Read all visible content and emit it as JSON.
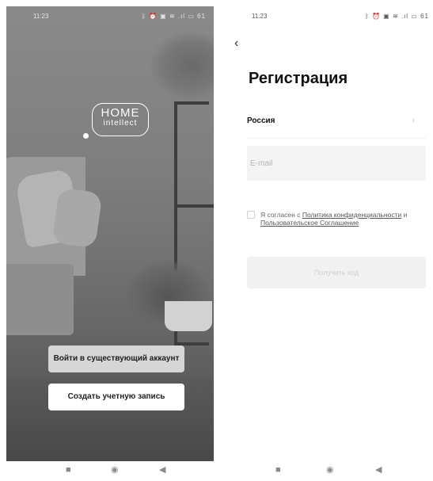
{
  "left_screen": {
    "status_bar": {
      "time": "11:23",
      "icons": "ᛒ ⏰ ▣ ≋ .ıl ▭ 61"
    },
    "logo": {
      "line1": "HOME",
      "line2": "intellect"
    },
    "buttons": {
      "login_label": "Войти в существующий аккаунт",
      "create_label": "Создать учетную запись"
    },
    "nav": {
      "recent": "■",
      "home": "◉",
      "back": "◀"
    }
  },
  "right_screen": {
    "status_bar": {
      "time": "11:23",
      "icons": "ᛒ ⏰ ▣ ≋ .ıl ▭ 61"
    },
    "title": "Регистрация",
    "country": {
      "value": "Россия"
    },
    "email": {
      "placeholder": "E-mail",
      "value": ""
    },
    "agreement": {
      "prefix": "Я согласен с ",
      "privacy_link": "Политика конфиденциальности",
      "middle": " и ",
      "terms_link": "Пользовательское Соглашение"
    },
    "submit_label": "Получить код",
    "nav": {
      "recent": "■",
      "home": "◉",
      "back": "◀"
    }
  },
  "colors": {
    "button_login_bg": "#d6d6d6",
    "button_create_bg": "#ffffff",
    "input_bg": "#f4f4f4",
    "submit_bg_disabled": "#f1f1f1"
  }
}
